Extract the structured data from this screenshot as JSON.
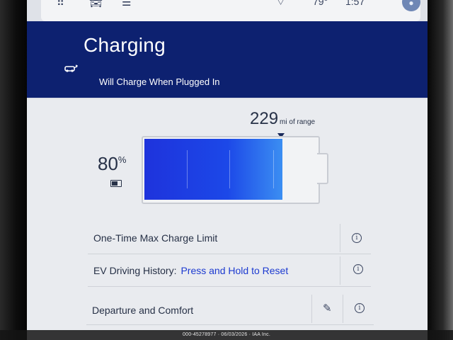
{
  "status_bar": {
    "temperature": "79°",
    "time": "1:57",
    "icons": [
      "apps-grid-icon",
      "vehicle-icon",
      "media-icon",
      "profile-icon"
    ]
  },
  "header": {
    "title": "Charging",
    "subtitle": "Will Charge When Plugged In",
    "background_color": "#0d2170"
  },
  "battery": {
    "range_value": "229",
    "range_unit": "mi of range",
    "charge_percent": "80",
    "percent_symbol": "%",
    "fill_fraction": 0.8,
    "fill_color": "#1e33dc"
  },
  "rows": [
    {
      "label": "One-Time Max Charge Limit",
      "link": "",
      "icons": [
        "info-icon"
      ]
    },
    {
      "label": "EV Driving History:",
      "link": "Press and Hold to Reset",
      "icons": [
        "info-icon"
      ]
    },
    {
      "label": "Departure and Comfort",
      "link": "",
      "icons": [
        "pencil-icon",
        "info-icon"
      ]
    }
  ],
  "accent_link_color": "#1c3ad0",
  "watermark": "000-45278977 · 06/03/2026 · IAA Inc."
}
